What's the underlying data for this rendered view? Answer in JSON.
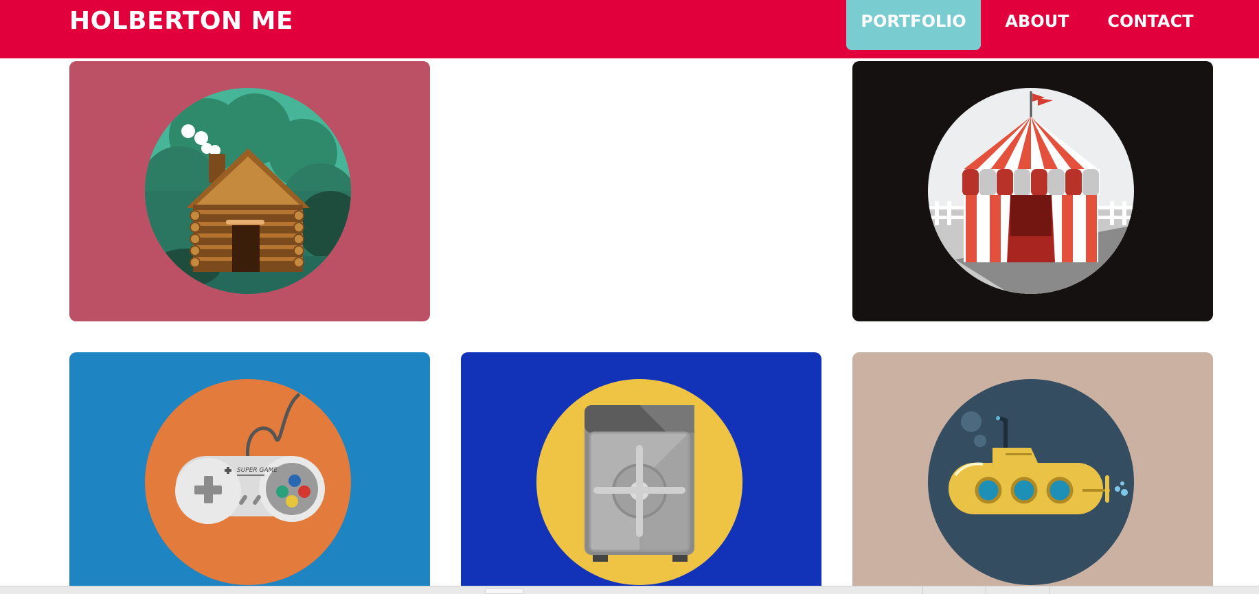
{
  "header": {
    "brand": "HOLBERTON ME",
    "nav": [
      {
        "label": "PORTFOLIO",
        "active": true
      },
      {
        "label": "ABOUT",
        "active": false
      },
      {
        "label": "CONTACT",
        "active": false
      }
    ]
  },
  "colors": {
    "header_bg": "#e1003b",
    "nav_active_bg": "#79cdd1",
    "card_cabin": "#bc5065",
    "card_circus": "#141110",
    "card_controller": "#1e84c2",
    "card_safe": "#1233b8",
    "card_submarine": "#cbb1a2"
  },
  "portfolio": [
    {
      "name": "log-cabin",
      "icon": "log-cabin-illustration"
    },
    {
      "name": "circus-tent",
      "icon": "circus-tent-illustration"
    },
    {
      "name": "game-controller",
      "icon": "game-controller-illustration",
      "text": "SUPER GAME"
    },
    {
      "name": "safe",
      "icon": "safe-illustration"
    },
    {
      "name": "submarine",
      "icon": "submarine-illustration"
    }
  ]
}
